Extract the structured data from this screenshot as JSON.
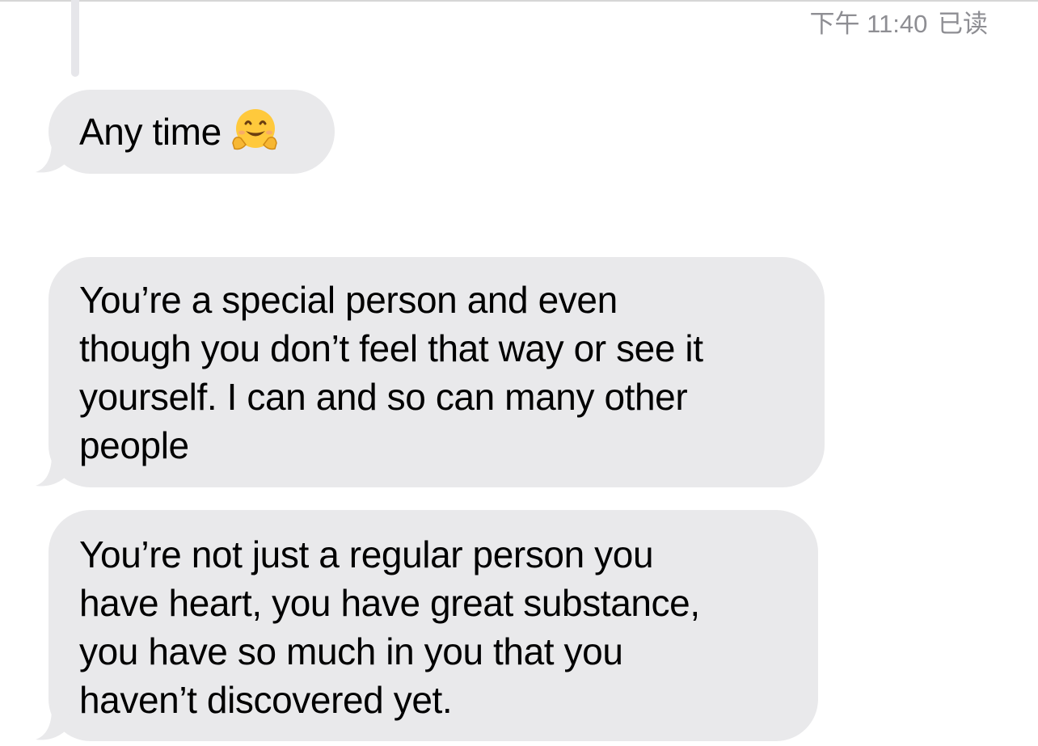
{
  "status": {
    "time": "下午 11:40",
    "read_label": "已读"
  },
  "messages": [
    {
      "lines": [
        "Any time"
      ],
      "emoji": "hugging-face-icon"
    },
    {
      "lines": [
        "You’re a special person and even",
        "though you don’t feel that way or see it",
        "yourself. I can and so can many other",
        "people"
      ]
    },
    {
      "lines": [
        "You’re not just a regular person you",
        "have heart, you have great substance,",
        "you have so much in you that you",
        "haven’t discovered yet."
      ]
    }
  ],
  "colors": {
    "bubble_bg": "#e9e9eb",
    "status_text": "#8e8e93",
    "emoji_face": "#ffc93c"
  }
}
